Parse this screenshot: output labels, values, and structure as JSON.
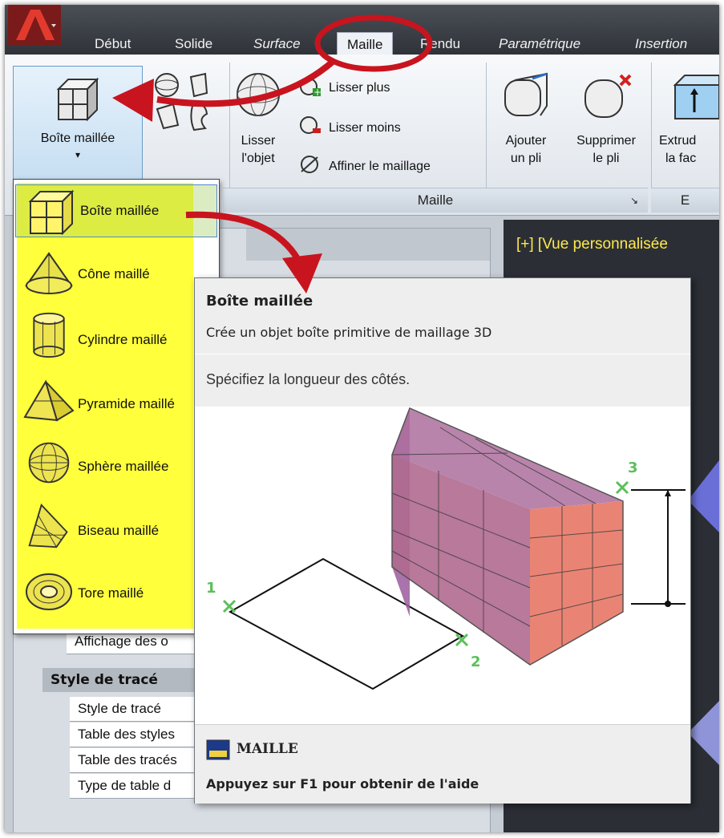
{
  "tabs": [
    {
      "label": "Début"
    },
    {
      "label": "Solide"
    },
    {
      "label": "Surface"
    },
    {
      "label": "Maille"
    },
    {
      "label": "Rendu"
    },
    {
      "label": "Paramétrique"
    },
    {
      "label": "Insertion"
    }
  ],
  "ribbon": {
    "boite_maillee_label": "Boîte maillée",
    "lisser_objet_line1": "Lisser",
    "lisser_objet_line2": "l'objet",
    "lisser_plus": "Lisser plus",
    "lisser_moins": "Lisser moins",
    "affiner": "Affiner le maillage",
    "ajouter_pli_line1": "Ajouter",
    "ajouter_pli_line2": "un pli",
    "supprimer_pli_line1": "Supprimer",
    "supprimer_pli_line2": "le pli",
    "extruder_line1": "Extrud",
    "extruder_line2": "la fac",
    "group_maille": "Maille",
    "group_partial": "E"
  },
  "dropdown": {
    "items": [
      {
        "label": "Boîte maillée",
        "icon": "mesh-box-icon"
      },
      {
        "label": "Cône maillé",
        "icon": "mesh-cone-icon"
      },
      {
        "label": "Cylindre maillé",
        "icon": "mesh-cylinder-icon"
      },
      {
        "label": "Pyramide maillé",
        "icon": "mesh-pyramid-icon"
      },
      {
        "label": "Sphère maillée",
        "icon": "mesh-sphere-icon"
      },
      {
        "label": "Biseau maillé",
        "icon": "mesh-wedge-icon"
      },
      {
        "label": "Tore maillé",
        "icon": "mesh-torus-icon"
      }
    ],
    "highlight_color": "#ffff3c"
  },
  "tooltip": {
    "title": "Boîte maillée",
    "description": "Crée un objet boîte primitive de maillage 3D",
    "prompt": "Spécifiez la longueur des côtés.",
    "point_labels": [
      "1",
      "2",
      "3"
    ],
    "command": "MAILLE",
    "help": "Appuyez sur F1 pour obtenir de l'aide"
  },
  "palette": {
    "partial_row": "Affichage des o",
    "section_title": "Style de tracé",
    "rows": [
      "Style de tracé",
      "Table des styles",
      "Table des tracés",
      "Type de table d"
    ]
  },
  "viewport": {
    "label": "[+] [Vue personnalisée"
  },
  "colors": {
    "annotation_red": "#c8141e",
    "box_face_left": "#9a5a9c",
    "box_face_right": "#e87d6d",
    "viewport_bg": "#2b2f35"
  }
}
